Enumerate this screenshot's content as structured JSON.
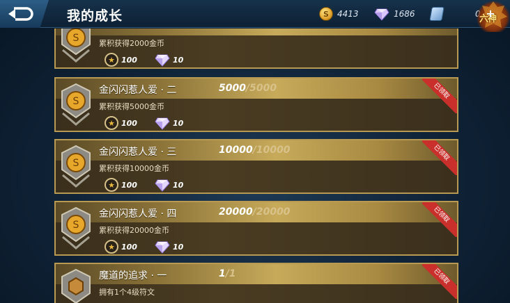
{
  "header": {
    "title": "我的成长",
    "gold": "4413",
    "diamonds": "1686",
    "coupons": "0",
    "logo_text": "六神",
    "plus": "+"
  },
  "achievements": [
    {
      "name": "",
      "progress_current": "",
      "progress_max": "",
      "description": "累积获得2000金币",
      "reward_exp": "100",
      "reward_gems": "10",
      "claimed": false
    },
    {
      "name": "金闪闪惹人爱 · 二",
      "progress_current": "5000",
      "progress_max": "5000",
      "description": "累积获得5000金币",
      "reward_exp": "100",
      "reward_gems": "10",
      "claimed": true
    },
    {
      "name": "金闪闪惹人爱 · 三",
      "progress_current": "10000",
      "progress_max": "10000",
      "description": "累积获得10000金币",
      "reward_exp": "100",
      "reward_gems": "10",
      "claimed": true
    },
    {
      "name": "金闪闪惹人爱 · 四",
      "progress_current": "20000",
      "progress_max": "20000",
      "description": "累积获得20000金币",
      "reward_exp": "100",
      "reward_gems": "10",
      "claimed": true
    },
    {
      "name": "魔道的追求 · 一",
      "progress_current": "1",
      "progress_max": "1",
      "description": "拥有1个4级符文",
      "reward_exp": "",
      "reward_gems": "",
      "claimed": true
    }
  ],
  "labels": {
    "claimed": "已领取",
    "separator": "/"
  },
  "icons": {
    "back": "back-arrow-icon",
    "gold": "gold-coin-icon",
    "diamond": "diamond-icon",
    "coupon": "coupon-icon",
    "exp": "exp-star-icon",
    "gem": "gem-icon",
    "medal": "coin-medal-icon"
  },
  "colors": {
    "card_border": "#b89a52",
    "claimed_ribbon": "#c9302c",
    "header_bg": "#16324b"
  }
}
